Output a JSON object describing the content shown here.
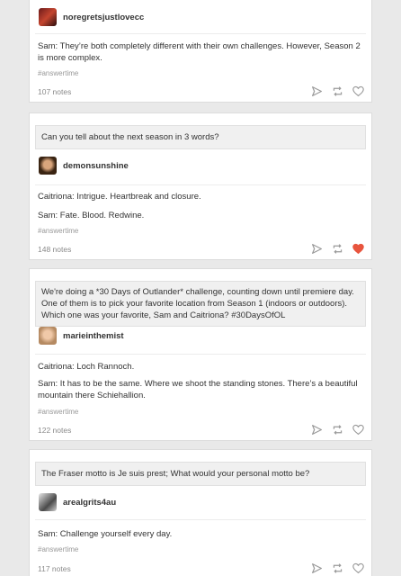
{
  "posts": [
    {
      "asker": "noregretsjustlovecc",
      "answers": [
        "Sam: They’re both completely different with their own challenges. However, Season 2 is more complex."
      ],
      "tag": "#answertime",
      "notes": "107 notes",
      "liked": false
    },
    {
      "question": "Can you tell about the next season in 3 words?",
      "asker": "demonsunshine",
      "answers": [
        "Caitriona: Intrigue. Heartbreak and closure.",
        "Sam: Fate. Blood. Redwine."
      ],
      "tag": "#answertime",
      "notes": "148 notes",
      "liked": true
    },
    {
      "question": "We're doing a *30 Days of Outlander* challenge, counting down until premiere day. One of them is to pick your favorite location from Season 1 (indoors or outdoors). Which one was your favorite, Sam and Caitriona? #30DaysOfOL",
      "asker": "marieinthemist",
      "answers": [
        "Caitriona: Loch Rannoch.",
        "Sam: It has to be the same. Where we shoot the standing stones. There’s a beautiful mountain there Schiehallion."
      ],
      "tag": "#answertime",
      "notes": "122 notes",
      "liked": false
    },
    {
      "question": "The Fraser motto is Je suis prest; What would your personal motto be?",
      "asker": "arealgrits4au",
      "answers": [
        "Sam: Challenge yourself every day."
      ],
      "tag": "#answertime",
      "notes": "117 notes",
      "liked": false
    }
  ],
  "icons": {
    "share": "paper-plane-icon",
    "reblog": "reblog-icon",
    "like": "heart-icon",
    "liked_color": "#e8553e",
    "icon_color": "#9a9a9a"
  }
}
